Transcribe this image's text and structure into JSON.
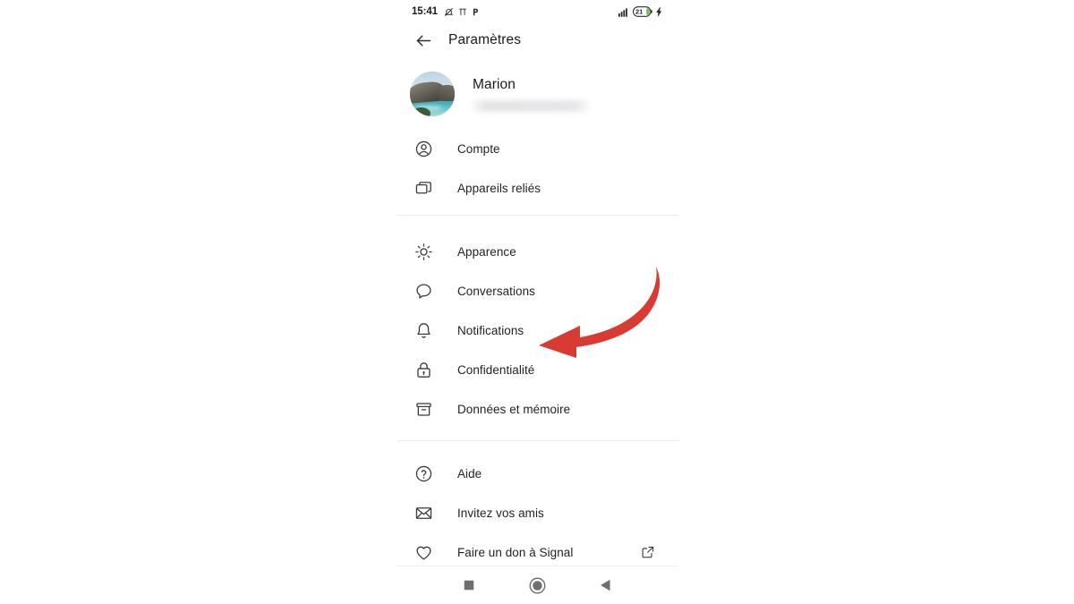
{
  "status_bar": {
    "clock": "15:41",
    "left_icons": [
      "bell-muted-icon",
      "vibrate-icon",
      "p-mode-icon"
    ],
    "signal_icon": "cellular-signal-icon",
    "battery_level": "21",
    "battery_charging_icon": "charging-bolt-icon"
  },
  "app_bar": {
    "back_icon": "back-arrow-icon",
    "title": "Paramètres"
  },
  "profile": {
    "avatar_icon": "avatar-photo",
    "name": "Marion",
    "phone_redacted": ""
  },
  "sections": [
    {
      "id": "account",
      "items": [
        {
          "icon": "person-circle-icon",
          "label": "Compte"
        },
        {
          "icon": "linked-devices-icon",
          "label": "Appareils reliés"
        }
      ]
    },
    {
      "id": "preferences",
      "items": [
        {
          "icon": "sun-icon",
          "label": "Apparence"
        },
        {
          "icon": "chat-bubble-icon",
          "label": "Conversations"
        },
        {
          "icon": "bell-icon",
          "label": "Notifications"
        },
        {
          "icon": "lock-icon",
          "label": "Confidentialité"
        },
        {
          "icon": "archive-box-icon",
          "label": "Données et mémoire"
        }
      ]
    },
    {
      "id": "support",
      "items": [
        {
          "icon": "question-circle-icon",
          "label": "Aide"
        },
        {
          "icon": "envelope-icon",
          "label": "Invitez vos amis"
        },
        {
          "icon": "heart-icon",
          "label": "Faire un don à Signal",
          "trailing_icon": "external-link-icon"
        }
      ]
    }
  ],
  "annotation": {
    "shape": "curved-arrow-pointing-left",
    "color": "#d93b33",
    "target_label": "Notifications"
  },
  "nav_bar": {
    "recents_icon": "square-recents-icon",
    "home_icon": "circle-home-icon",
    "back_icon": "triangle-back-icon"
  },
  "colors": {
    "background": "#ffffff",
    "text_primary": "#1b1b1b",
    "text_secondary": "#232323",
    "icon": "#3b3b3b",
    "divider": "#eceded",
    "accent_red": "#d93b33",
    "battery_green": "#6dc05a"
  }
}
